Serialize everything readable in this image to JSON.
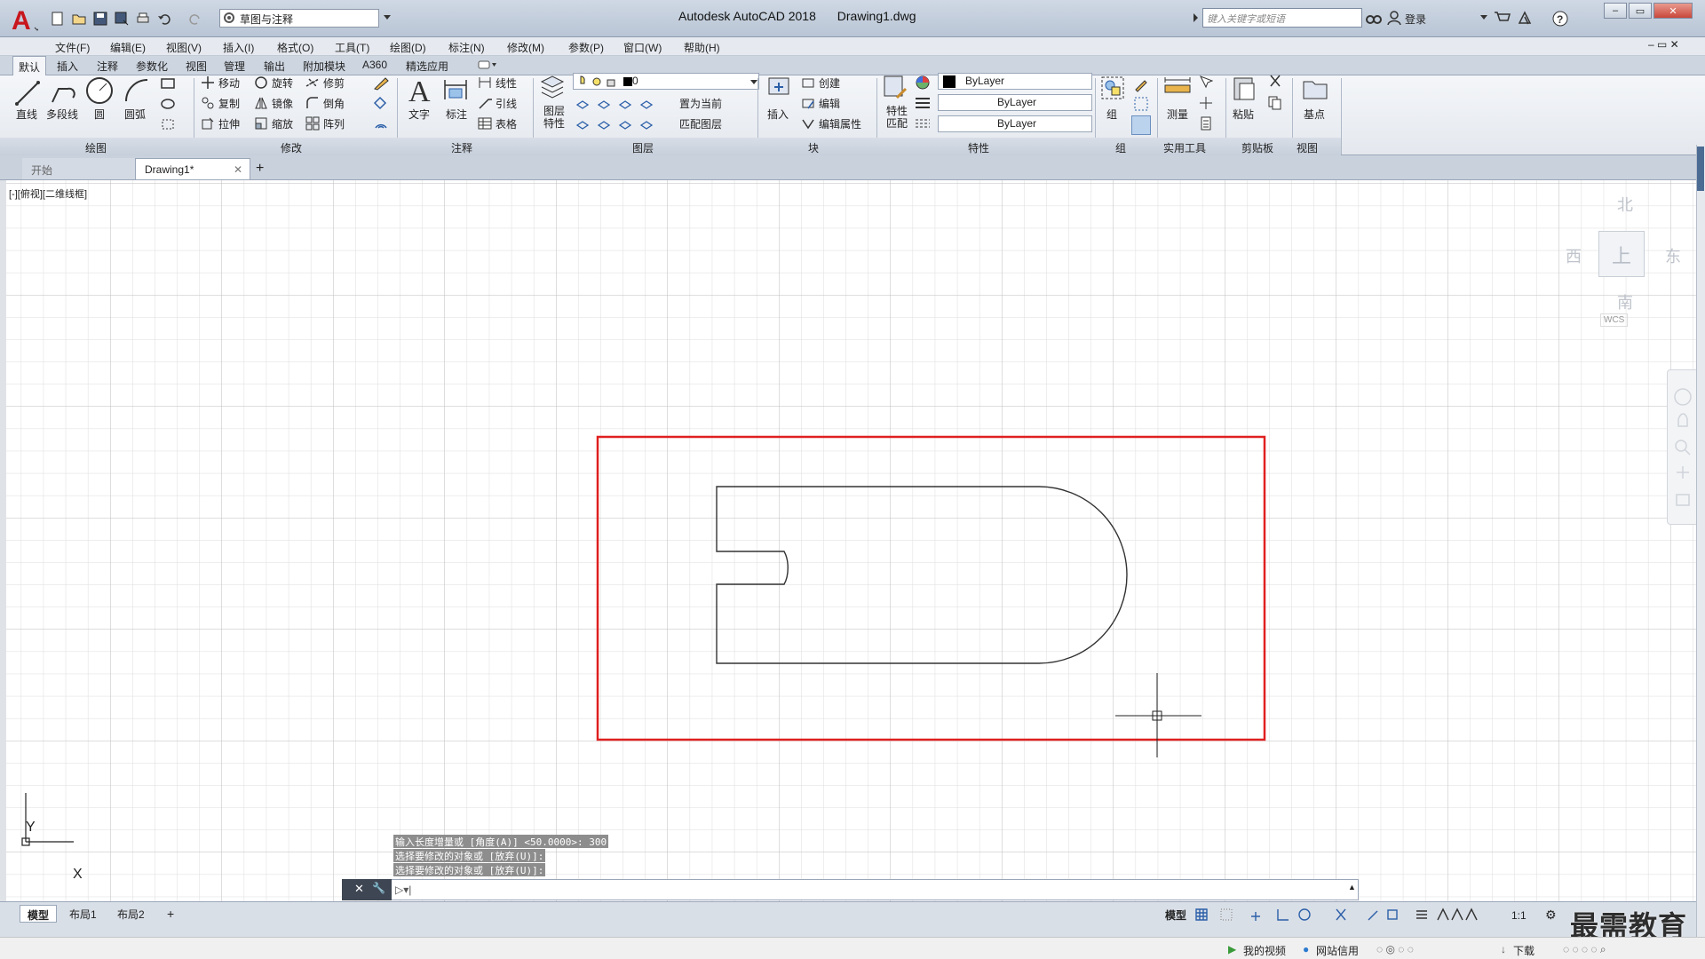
{
  "titlebar": {
    "app_title": "Autodesk AutoCAD 2018",
    "document": "Drawing1.dwg",
    "workspace": "草图与注释",
    "search_placeholder": "键入关键字或短语",
    "login": "登录"
  },
  "menubar": [
    "文件(F)",
    "编辑(E)",
    "视图(V)",
    "插入(I)",
    "格式(O)",
    "工具(T)",
    "绘图(D)",
    "标注(N)",
    "修改(M)",
    "参数(P)",
    "窗口(W)",
    "帮助(H)"
  ],
  "ribbon_tabs": [
    "默认",
    "插入",
    "注释",
    "参数化",
    "视图",
    "管理",
    "输出",
    "附加模块",
    "A360",
    "精选应用"
  ],
  "panels": {
    "draw": {
      "title": "绘图",
      "line": "直线",
      "polyline": "多段线",
      "circle": "圆",
      "arc": "圆弧"
    },
    "modify": {
      "title": "修改",
      "move": "移动",
      "rotate": "旋转",
      "trim": "修剪",
      "copy": "复制",
      "mirror": "镜像",
      "fillet": "倒角",
      "stretch": "拉伸",
      "scale": "缩放",
      "array": "阵列"
    },
    "annotation": {
      "title": "注释",
      "text": "文字",
      "dimension": "标注",
      "linear": "线性",
      "leader": "引线",
      "table": "表格"
    },
    "layers": {
      "title": "图层",
      "layer_props": "图层\n特性",
      "current_layer": "0",
      "set_current": "置为当前",
      "match_layer": "匹配图层"
    },
    "block": {
      "title": "块",
      "insert": "插入",
      "create": "创建",
      "edit": "编辑",
      "edit_attr": "编辑属性"
    },
    "properties": {
      "title": "特性",
      "match": "特性\n匹配",
      "color": "ByLayer",
      "lineweight": "ByLayer",
      "linetype": "ByLayer"
    },
    "groups": {
      "title": "组",
      "group": "组"
    },
    "utilities": {
      "title": "实用工具",
      "measure": "测量"
    },
    "clipboard": {
      "title": "剪贴板",
      "paste": "粘贴"
    },
    "view": {
      "title": "视图",
      "base": "基点"
    }
  },
  "doc_tabs": {
    "start": "开始",
    "drawing": "Drawing1*"
  },
  "viewport": {
    "label": "[-][俯视][二维线框]",
    "north": "北",
    "south": "南",
    "east": "东",
    "west": "西",
    "top": "上",
    "wcs": "WCS",
    "ucs_x": "X",
    "ucs_y": "Y"
  },
  "command_history": [
    "输入长度增量或 [角度(A)] <50.0000>: 300",
    "选择要修改的对象或 [放弃(U)]:",
    "选择要修改的对象或 [放弃(U)]:"
  ],
  "layout_tabs": [
    "模型",
    "布局1",
    "布局2"
  ],
  "status": {
    "model": "模型",
    "scale": "1:1"
  },
  "bottombar": {
    "my_video": "我的视频",
    "net_credit": "网站信用",
    "download": "下载"
  },
  "watermark": "最需教育",
  "colors": {
    "selection_rect": "#e02020",
    "accent": "#4b6b93",
    "logo_red": "#c8161d"
  }
}
